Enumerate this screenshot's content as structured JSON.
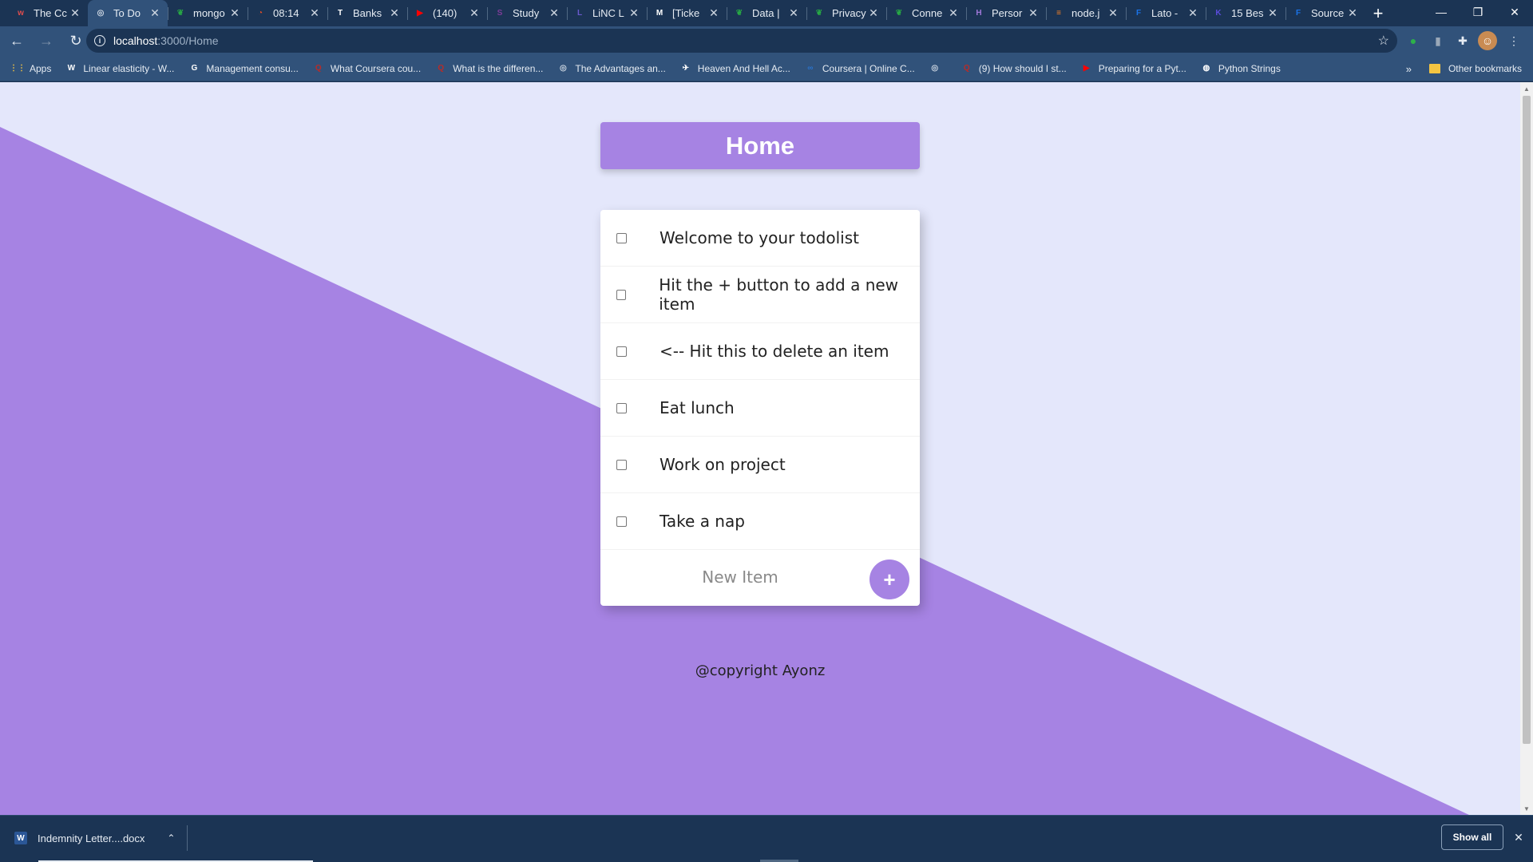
{
  "browser": {
    "tabs": [
      {
        "title": "The Cc",
        "icon": "red-logo-icon",
        "color": "#e04d4d",
        "glyph": "w"
      },
      {
        "title": "To Do",
        "icon": "globe-icon",
        "color": "#cfd8e3",
        "glyph": "◎"
      },
      {
        "title": "mongo",
        "icon": "mongodb-leaf-icon",
        "color": "#27a844",
        "glyph": "❦"
      },
      {
        "title": "08:14",
        "icon": "timer-icon",
        "color": "#e34c26",
        "glyph": "◔"
      },
      {
        "title": "Banks",
        "icon": "bank-icon",
        "color": "#ffffff",
        "glyph": "T"
      },
      {
        "title": "(140)",
        "icon": "youtube-icon",
        "color": "#ff0000",
        "glyph": "▶"
      },
      {
        "title": "Study",
        "icon": "study-icon",
        "color": "#7d3c98",
        "glyph": "S"
      },
      {
        "title": "LiNC L",
        "icon": "linc-icon",
        "color": "#6a5acd",
        "glyph": "L"
      },
      {
        "title": "[Ticke",
        "icon": "gmail-icon",
        "color": "#ffffff",
        "glyph": "M"
      },
      {
        "title": "Data |",
        "icon": "mongodb-leaf-icon",
        "color": "#27a844",
        "glyph": "❦"
      },
      {
        "title": "Privacy",
        "icon": "mongodb-leaf-icon",
        "color": "#27a844",
        "glyph": "❦"
      },
      {
        "title": "Conne",
        "icon": "mongodb-leaf-icon",
        "color": "#27a844",
        "glyph": "❦"
      },
      {
        "title": "Persor",
        "icon": "heroku-icon",
        "color": "#a178d9",
        "glyph": "H"
      },
      {
        "title": "node.j",
        "icon": "stackoverflow-icon",
        "color": "#f48024",
        "glyph": "≡"
      },
      {
        "title": "Lato -",
        "icon": "google-fonts-icon",
        "color": "#1a73e8",
        "glyph": "F"
      },
      {
        "title": "15 Bes",
        "icon": "k-logo-icon",
        "color": "#5b4cdb",
        "glyph": "K"
      },
      {
        "title": "Source",
        "icon": "google-fonts-icon",
        "color": "#1a73e8",
        "glyph": "F"
      }
    ],
    "new_tab_label": "+",
    "window_controls": {
      "minimize": "—",
      "restore": "❐",
      "close": "✕"
    },
    "address": {
      "host": "localhost",
      "path": ":3000/Home"
    },
    "bookmarks": [
      {
        "label": "Apps",
        "icon": "apps-grid-icon",
        "color": "#f4c542",
        "glyph": "⋮⋮"
      },
      {
        "label": "Linear elasticity - W...",
        "icon": "wikipedia-icon",
        "color": "#ffffff",
        "glyph": "W"
      },
      {
        "label": "Management consu...",
        "icon": "google-icon",
        "color": "#ffffff",
        "glyph": "G"
      },
      {
        "label": "What Coursera cou...",
        "icon": "quora-icon",
        "color": "#b92b27",
        "glyph": "Q"
      },
      {
        "label": "What is the differen...",
        "icon": "quora-icon",
        "color": "#b92b27",
        "glyph": "Q"
      },
      {
        "label": "The Advantages an...",
        "icon": "globe-icon",
        "color": "#cfd8e3",
        "glyph": "◎"
      },
      {
        "label": "Heaven And Hell Ac...",
        "icon": "bird-icon",
        "color": "#ffffff",
        "glyph": "✈"
      },
      {
        "label": "Coursera | Online C...",
        "icon": "coursera-icon",
        "color": "#2a73cc",
        "glyph": "∞"
      },
      {
        "label": "",
        "icon": "globe-icon",
        "color": "#cfd8e3",
        "glyph": "◎"
      },
      {
        "label": "(9) How should I st...",
        "icon": "quora-icon",
        "color": "#b92b27",
        "glyph": "Q"
      },
      {
        "label": "Preparing for a Pyt...",
        "icon": "youtube-icon",
        "color": "#ff0000",
        "glyph": "▶"
      },
      {
        "label": "Python Strings",
        "icon": "python-icon",
        "color": "#ffffff",
        "glyph": "◍"
      }
    ],
    "bookmarks_overflow": "»",
    "other_bookmarks": "Other bookmarks"
  },
  "page": {
    "title": "Home",
    "items": [
      {
        "text": "Welcome to your todolist",
        "checked": false
      },
      {
        "text": "Hit the + button to add a new item",
        "checked": false
      },
      {
        "text": "<-- Hit this to delete an item",
        "checked": false
      },
      {
        "text": "Eat lunch",
        "checked": false
      },
      {
        "text": "Work on project",
        "checked": false
      },
      {
        "text": "Take a nap",
        "checked": false
      }
    ],
    "new_item_placeholder": "New Item",
    "add_button_label": "+",
    "footer": "@copyright Ayonz",
    "colors": {
      "accent": "#a683e3",
      "background": "#e4e7fb"
    }
  },
  "downloads": {
    "file": "Indemnity Letter....docx",
    "show_all": "Show all",
    "close": "✕"
  }
}
